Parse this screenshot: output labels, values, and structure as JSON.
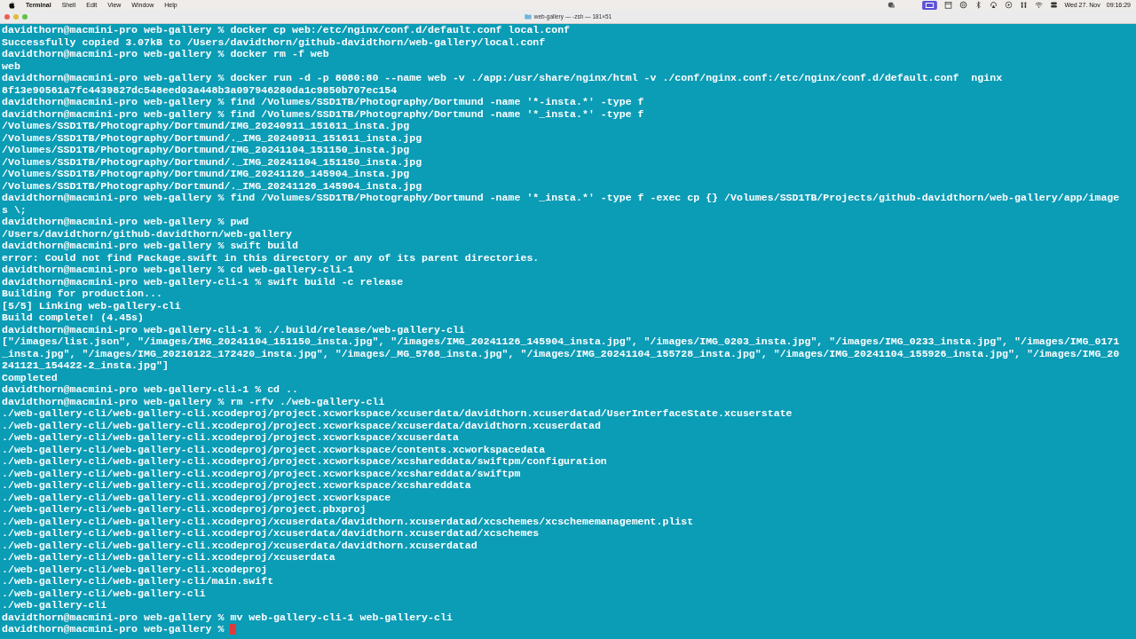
{
  "menu_bar": {
    "app": "Terminal",
    "items": [
      "Shell",
      "Edit",
      "View",
      "Window",
      "Help"
    ],
    "date": "Wed 27. Nov",
    "time": "09:16:29"
  },
  "window": {
    "title": "web-gallery — -zsh — 181×51"
  },
  "terminal": {
    "cursor": true,
    "lines": [
      "davidthorn@macmini-pro web-gallery % docker cp web:/etc/nginx/conf.d/default.conf local.conf",
      "Successfully copied 3.07kB to /Users/davidthorn/github-davidthorn/web-gallery/local.conf",
      "davidthorn@macmini-pro web-gallery % docker rm -f web",
      "web",
      "davidthorn@macmini-pro web-gallery % docker run -d -p 8080:80 --name web -v ./app:/usr/share/nginx/html -v ./conf/nginx.conf:/etc/nginx/conf.d/default.conf  nginx",
      "8f13e90561a7fc4439827dc548eed03a448b3a097946280da1c9850b707ec154",
      "davidthorn@macmini-pro web-gallery % find /Volumes/SSD1TB/Photography/Dortmund -name '*-insta.*' -type f",
      "davidthorn@macmini-pro web-gallery % find /Volumes/SSD1TB/Photography/Dortmund -name '*_insta.*' -type f",
      "/Volumes/SSD1TB/Photography/Dortmund/IMG_20240911_151611_insta.jpg",
      "/Volumes/SSD1TB/Photography/Dortmund/._IMG_20240911_151611_insta.jpg",
      "/Volumes/SSD1TB/Photography/Dortmund/IMG_20241104_151150_insta.jpg",
      "/Volumes/SSD1TB/Photography/Dortmund/._IMG_20241104_151150_insta.jpg",
      "/Volumes/SSD1TB/Photography/Dortmund/IMG_20241126_145904_insta.jpg",
      "/Volumes/SSD1TB/Photography/Dortmund/._IMG_20241126_145904_insta.jpg",
      "davidthorn@macmini-pro web-gallery % find /Volumes/SSD1TB/Photography/Dortmund -name '*_insta.*' -type f -exec cp {} /Volumes/SSD1TB/Projects/github-davidthorn/web-gallery/app/image",
      "s \\;",
      "davidthorn@macmini-pro web-gallery % pwd",
      "/Users/davidthorn/github-davidthorn/web-gallery",
      "davidthorn@macmini-pro web-gallery % swift build",
      "error: Could not find Package.swift in this directory or any of its parent directories.",
      "davidthorn@macmini-pro web-gallery % cd web-gallery-cli-1",
      "davidthorn@macmini-pro web-gallery-cli-1 % swift build -c release",
      "Building for production...",
      "[5/5] Linking web-gallery-cli",
      "Build complete! (4.45s)",
      "davidthorn@macmini-pro web-gallery-cli-1 % ./.build/release/web-gallery-cli",
      "[\"/images/list.json\", \"/images/IMG_20241104_151150_insta.jpg\", \"/images/IMG_20241126_145904_insta.jpg\", \"/images/IMG_0203_insta.jpg\", \"/images/IMG_0233_insta.jpg\", \"/images/IMG_0171",
      "_insta.jpg\", \"/images/IMG_20210122_172420_insta.jpg\", \"/images/_MG_5768_insta.jpg\", \"/images/IMG_20241104_155728_insta.jpg\", \"/images/IMG_20241104_155926_insta.jpg\", \"/images/IMG_20",
      "241121_154422-2_insta.jpg\"]",
      "Completed",
      "davidthorn@macmini-pro web-gallery-cli-1 % cd ..",
      "davidthorn@macmini-pro web-gallery % rm -rfv ./web-gallery-cli",
      "./web-gallery-cli/web-gallery-cli.xcodeproj/project.xcworkspace/xcuserdata/davidthorn.xcuserdatad/UserInterfaceState.xcuserstate",
      "./web-gallery-cli/web-gallery-cli.xcodeproj/project.xcworkspace/xcuserdata/davidthorn.xcuserdatad",
      "./web-gallery-cli/web-gallery-cli.xcodeproj/project.xcworkspace/xcuserdata",
      "./web-gallery-cli/web-gallery-cli.xcodeproj/project.xcworkspace/contents.xcworkspacedata",
      "./web-gallery-cli/web-gallery-cli.xcodeproj/project.xcworkspace/xcshareddata/swiftpm/configuration",
      "./web-gallery-cli/web-gallery-cli.xcodeproj/project.xcworkspace/xcshareddata/swiftpm",
      "./web-gallery-cli/web-gallery-cli.xcodeproj/project.xcworkspace/xcshareddata",
      "./web-gallery-cli/web-gallery-cli.xcodeproj/project.xcworkspace",
      "./web-gallery-cli/web-gallery-cli.xcodeproj/project.pbxproj",
      "./web-gallery-cli/web-gallery-cli.xcodeproj/xcuserdata/davidthorn.xcuserdatad/xcschemes/xcschememanagement.plist",
      "./web-gallery-cli/web-gallery-cli.xcodeproj/xcuserdata/davidthorn.xcuserdatad/xcschemes",
      "./web-gallery-cli/web-gallery-cli.xcodeproj/xcuserdata/davidthorn.xcuserdatad",
      "./web-gallery-cli/web-gallery-cli.xcodeproj/xcuserdata",
      "./web-gallery-cli/web-gallery-cli.xcodeproj",
      "./web-gallery-cli/web-gallery-cli/main.swift",
      "./web-gallery-cli/web-gallery-cli",
      "./web-gallery-cli",
      "davidthorn@macmini-pro web-gallery % mv web-gallery-cli-1 web-gallery-cli",
      "davidthorn@macmini-pro web-gallery % "
    ]
  }
}
